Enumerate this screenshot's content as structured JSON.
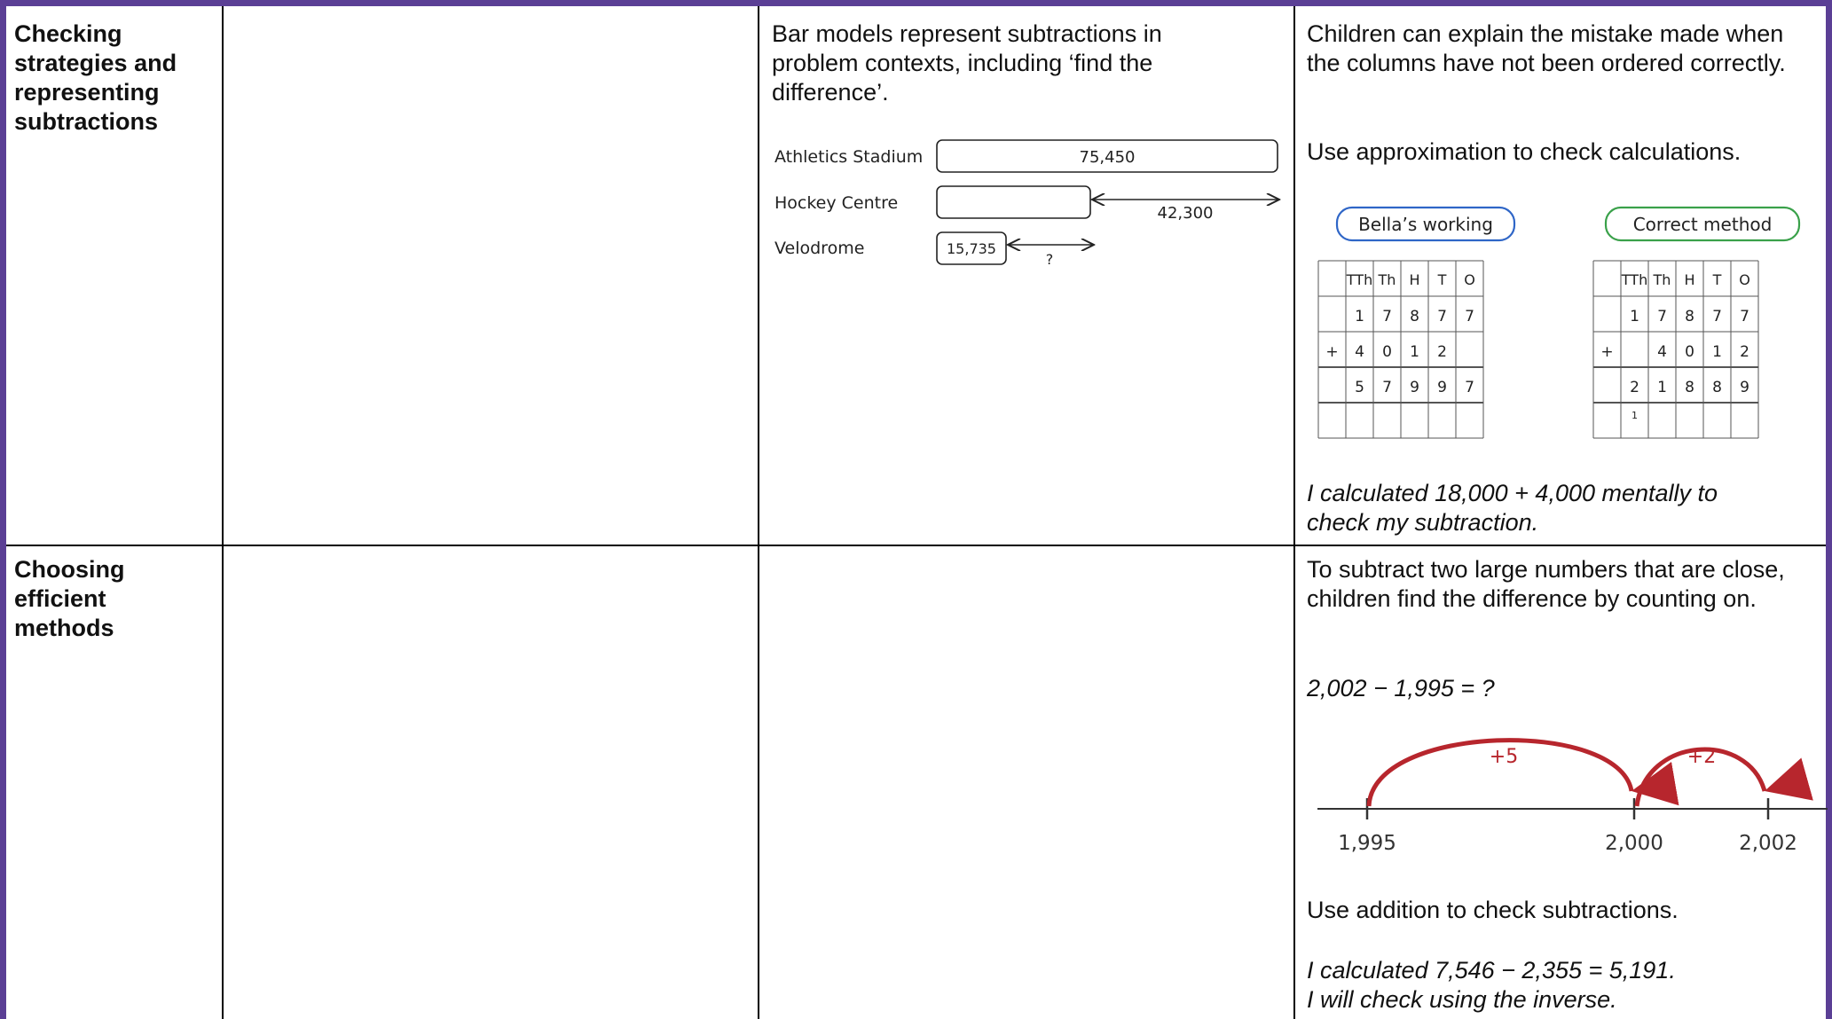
{
  "rows": [
    {
      "topic": "Checking strategies and representing subtractions",
      "col3": {
        "text": "Bar models represent subtractions in problem contexts, including ‘find the difference’.",
        "bar_model": {
          "labels": [
            "Athletics Stadium",
            "Hockey Centre",
            "Velodrome"
          ],
          "athletics_value": "75,450",
          "hockey_diff": "42,300",
          "velodrome_value": "15,735",
          "velodrome_diff": "?"
        }
      },
      "col4": {
        "text1": "Children can explain the mistake made when the columns have not been ordered correctly.",
        "text2": "Use approximation to check calculations.",
        "bella_title": "Bella’s working",
        "correct_title": "Correct method",
        "headers_bella": [
          "TTh",
          "Th",
          "H",
          "T",
          "O"
        ],
        "headers_correct": [
          "TTh",
          "Th",
          "H",
          "T",
          "O"
        ],
        "bella_rows": [
          [
            "",
            "1",
            "7",
            "8",
            "7",
            "7"
          ],
          [
            "+",
            "4",
            "0",
            "1",
            "2",
            ""
          ],
          [
            "",
            "5",
            "7",
            "9",
            "9",
            "7"
          ]
        ],
        "correct_rows": [
          [
            "",
            "1",
            "7",
            "8",
            "7",
            "7"
          ],
          [
            "+",
            "",
            "4",
            "0",
            "1",
            "2"
          ],
          [
            "",
            "2",
            "1",
            "8",
            "8",
            "9"
          ]
        ],
        "correct_carry": "1",
        "italic_text": "I calculated 18,000 + 4,000 mentally to check my subtraction."
      }
    },
    {
      "topic": "Choosing efficient methods",
      "col4": {
        "text1": "To subtract two large numbers that are close, children find the difference by counting on.",
        "equation": "2,002 − 1,995 = ?",
        "number_line": {
          "jump1_label": "+5",
          "jump2_label": "+2",
          "tick_labels": [
            "1,995",
            "2,000",
            "2,002"
          ]
        },
        "text2": "Use addition to check subtractions.",
        "italic_line1": "I calculated 7,546 − 2,355 = 5,191.",
        "italic_line2": "I will check using the inverse."
      }
    }
  ],
  "colors": {
    "frame": "#5b3f95",
    "bella_border": "#2f66c7",
    "correct_border": "#3aa14a",
    "jump_arrow": "#b7262d"
  }
}
